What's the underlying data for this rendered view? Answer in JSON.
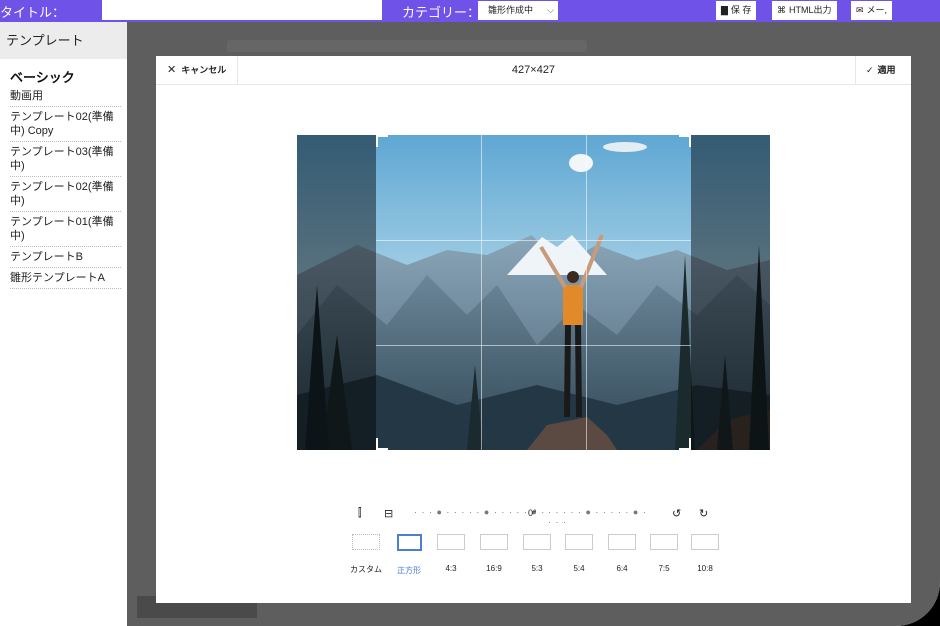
{
  "topbar": {
    "title_label": "タイトル：",
    "category_label": "カテゴリー：",
    "category_value": "雛形作成中",
    "save_label": "保 存",
    "html_export_label": "HTML出力",
    "mail_label": "メー,"
  },
  "sidebar": {
    "header": "テンプレート",
    "section": "ベーシック",
    "items": [
      {
        "label": "動画用"
      },
      {
        "label": "テンプレート02(準備中) Copy"
      },
      {
        "label": "テンプレート03(準備中)"
      },
      {
        "label": "テンプレート02(準備中)"
      },
      {
        "label": "テンプレート01(準備中)"
      },
      {
        "label": "テンプレートB"
      },
      {
        "label": "雛形テンプレートA"
      }
    ]
  },
  "crop_modal": {
    "cancel_label": "キャンセル",
    "dimensions": "427×427",
    "apply_label": "適用",
    "rotation": "0°",
    "ratios": [
      {
        "label": "カスタム"
      },
      {
        "label": "正方形"
      },
      {
        "label": "4:3"
      },
      {
        "label": "16:9"
      },
      {
        "label": "5:3"
      },
      {
        "label": "5:4"
      },
      {
        "label": "6:4"
      },
      {
        "label": "7:5"
      },
      {
        "label": "10:8"
      }
    ]
  },
  "colors": {
    "brand": "#6f53e9",
    "active_ratio": "#4a7fd4"
  }
}
